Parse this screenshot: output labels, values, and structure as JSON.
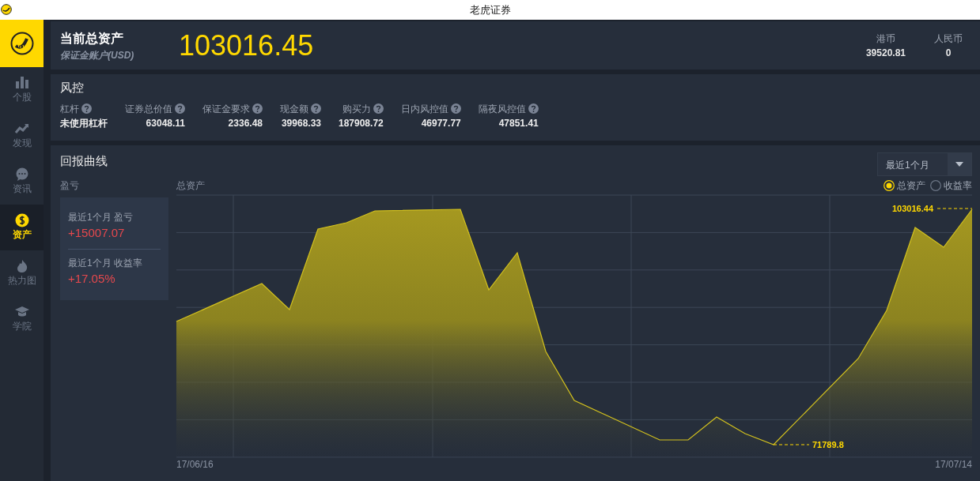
{
  "window": {
    "title": "老虎证券"
  },
  "sidebar": {
    "items": [
      {
        "label": "个股",
        "selected": false
      },
      {
        "label": "发现",
        "selected": false
      },
      {
        "label": "资讯",
        "selected": false
      },
      {
        "label": "资产",
        "selected": true
      },
      {
        "label": "热力图",
        "selected": false
      },
      {
        "label": "学院",
        "selected": false
      }
    ]
  },
  "header": {
    "title": "当前总资产",
    "subtitle": "保证金账户(USD)",
    "total": "103016.45",
    "currencies": [
      {
        "label": "港币",
        "value": "39520.81"
      },
      {
        "label": "人民币",
        "value": "0"
      }
    ]
  },
  "risk": {
    "title": "风控",
    "metrics": [
      {
        "label": "杠杆",
        "value": "未使用杠杆"
      },
      {
        "label": "证券总价值",
        "value": "63048.11"
      },
      {
        "label": "保证金要求",
        "value": "2336.48"
      },
      {
        "label": "现金额",
        "value": "39968.33"
      },
      {
        "label": "购买力",
        "value": "187908.72"
      },
      {
        "label": "日内风控值",
        "value": "46977.77"
      },
      {
        "label": "隔夜风控值",
        "value": "47851.41"
      }
    ]
  },
  "returns": {
    "title": "回报曲线",
    "pnl_label": "盈亏",
    "summary": [
      {
        "label": "最近1个月 盈亏",
        "value": "+15007.07"
      },
      {
        "label": "最近1个月 收益率",
        "value": "+17.05%"
      }
    ],
    "range": {
      "value": "最近1个月"
    },
    "toggles": [
      {
        "label": "总资产",
        "selected": true
      },
      {
        "label": "收益率",
        "selected": false
      }
    ],
    "chart": {
      "title": "总资产",
      "max_label": "103016.44",
      "min_label": "71789.8",
      "start_date": "17/06/16",
      "end_date": "17/07/14"
    }
  }
}
